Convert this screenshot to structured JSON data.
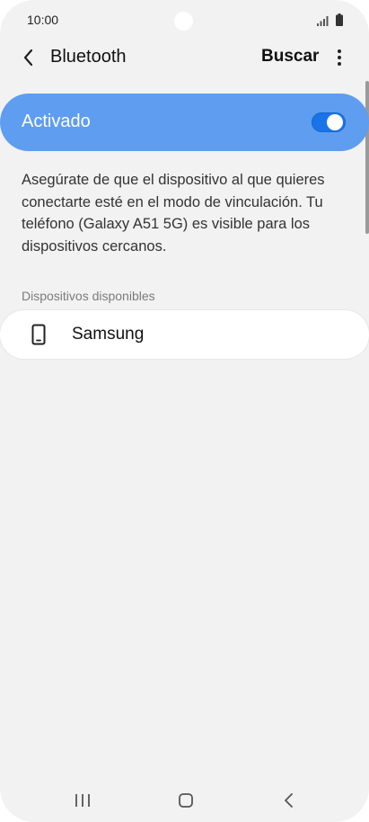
{
  "status_bar": {
    "time": "10:00",
    "icons": [
      "signal-icon",
      "battery-icon"
    ]
  },
  "header": {
    "title": "Bluetooth",
    "back_icon": "chevron-left-icon",
    "search_label": "Buscar",
    "more_icon": "more-vertical-icon"
  },
  "bluetooth_toggle": {
    "label": "Activado",
    "enabled": true
  },
  "description": "Asegúrate de que el dispositivo al que quieres conectarte esté en el modo de vinculación. Tu teléfono (Galaxy A51 5G) es visible para los dispositivos cercanos.",
  "available_devices": {
    "header": "Dispositivos disponibles",
    "items": [
      {
        "name": "Samsung",
        "icon": "phone-icon"
      }
    ]
  },
  "navigation_bar": {
    "icons": [
      "recents-icon",
      "home-icon",
      "back-icon"
    ]
  },
  "colors": {
    "background": "#f2f2f2",
    "toggle_bar": "#5e9df0",
    "switch_track": "#1a73e8",
    "card": "#ffffff",
    "section_header": "#7b7b7b"
  }
}
